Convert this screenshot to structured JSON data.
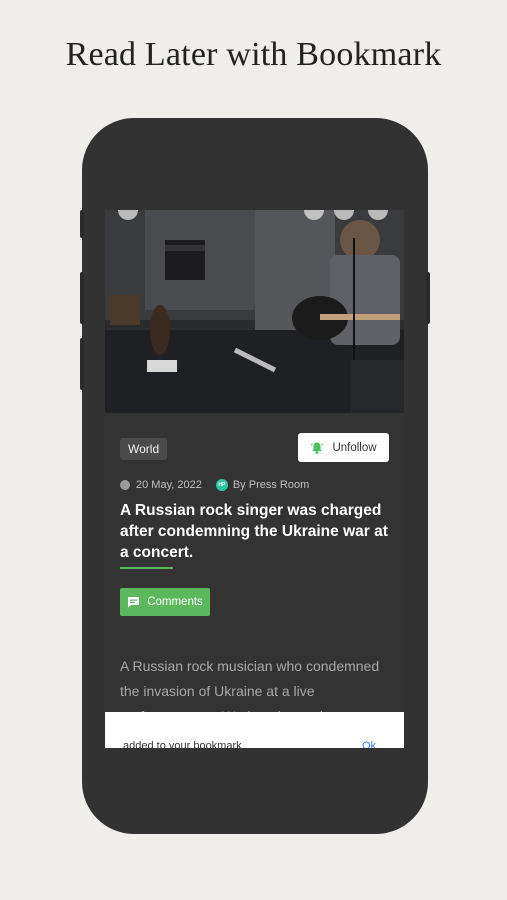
{
  "promo": {
    "headline": "Read Later with Bookmark"
  },
  "article": {
    "category": "World",
    "follow_label": "Unfollow",
    "date": "20 May, 2022",
    "author": "By Press Room",
    "author_initials": "HP",
    "title": "A Russian rock singer was charged after condemning the Ukraine war at a concert.",
    "comments_label": "Comments",
    "body": "A Russian rock musician who condemned the invasion of Ukraine at a live performance on Wednesday and"
  },
  "toast": {
    "message": "added to your bookmark",
    "action": "Ok"
  },
  "colors": {
    "accent": "#5cb85c",
    "bell": "#49c25b",
    "background": "#efeeea",
    "phone": "#323232"
  }
}
